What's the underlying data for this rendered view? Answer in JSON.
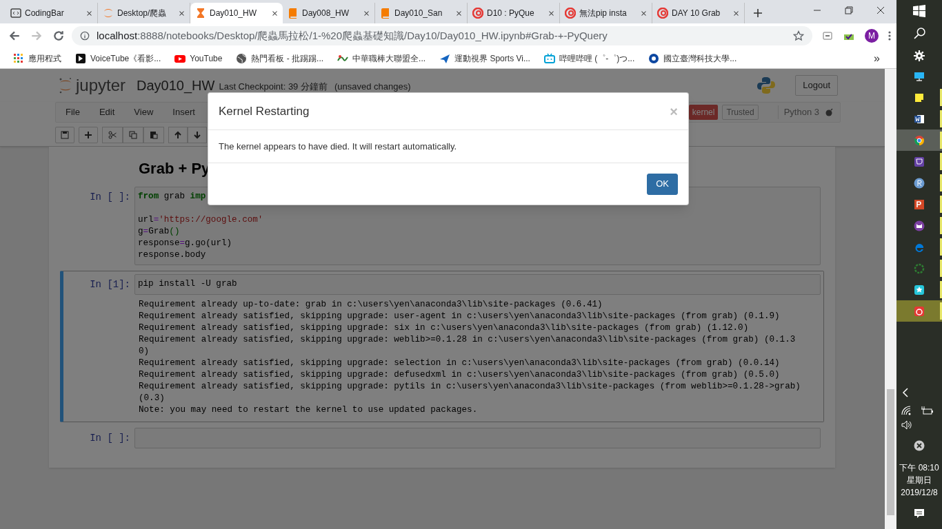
{
  "browser": {
    "tabs": [
      {
        "kind": "code",
        "title": "CodingBar",
        "selected": false
      },
      {
        "kind": "ring",
        "title": "Desktop/爬蟲",
        "selected": false
      },
      {
        "kind": "hourglass",
        "title": "Day010_HW",
        "selected": true
      },
      {
        "kind": "book",
        "title": "Day008_HW",
        "selected": false
      },
      {
        "kind": "book",
        "title": "Day010_San",
        "selected": false
      },
      {
        "kind": "swirl",
        "title": "D10 : PyQue",
        "selected": false
      },
      {
        "kind": "swirl",
        "title": "無法pip insta",
        "selected": false
      },
      {
        "kind": "swirl",
        "title": "DAY 10 Grab",
        "selected": false
      }
    ],
    "url_host": "localhost",
    "url_path": ":8888/notebooks/Desktop/爬蟲馬拉松/1-%20爬蟲基礎知識/Day10/Day010_HW.ipynb#Grab-+-PyQuery",
    "profile": "M",
    "bookmarks": [
      {
        "kind": "apps",
        "label": "應用程式"
      },
      {
        "kind": "voicetube",
        "label": "VoiceTube《看影..."
      },
      {
        "kind": "youtube",
        "label": "YouTube"
      },
      {
        "kind": "globe",
        "label": "熱門看板 - 批踢踢..."
      },
      {
        "kind": "cpbl",
        "label": "中華職棒大聯盟全..."
      },
      {
        "kind": "plane",
        "label": "運動視界 Sports Vi..."
      },
      {
        "kind": "tv",
        "label": "哔哩哔哩 (゜-゜)つ..."
      },
      {
        "kind": "school",
        "label": "國立臺灣科技大學..."
      }
    ],
    "more": "»"
  },
  "notebook": {
    "logo_text": "jupyter",
    "name": "Day010_HW",
    "checkpoint": "Last Checkpoint: 39 分鐘前",
    "unsaved": "(unsaved changes)",
    "logout": "Logout",
    "menu": [
      "File",
      "Edit",
      "View",
      "Insert"
    ],
    "kernel_status": "kernel",
    "trusted": "Trusted",
    "kernel_name": "Python 3",
    "heading": "Grab + Py",
    "cells": [
      {
        "prompt": "In [ ]:",
        "selected": false,
        "lines": [
          {
            "tokens": [
              {
                "kind": "keyword",
                "text": "from"
              },
              {
                "kind": "plain",
                "text": " grab "
              },
              {
                "kind": "keyword",
                "text": "imp"
              }
            ]
          },
          {
            "blank": true
          },
          {
            "tokens": [
              {
                "kind": "plain",
                "text": "url"
              },
              {
                "kind": "operator",
                "text": "="
              },
              {
                "kind": "string",
                "text": "'https://google.com'"
              }
            ]
          },
          {
            "tokens": [
              {
                "kind": "plain",
                "text": "g"
              },
              {
                "kind": "operator",
                "text": "="
              },
              {
                "kind": "plain",
                "text": "Grab"
              },
              {
                "kind": "paren",
                "text": "()"
              }
            ]
          },
          {
            "tokens": [
              {
                "kind": "plain",
                "text": "response"
              },
              {
                "kind": "operator",
                "text": "="
              },
              {
                "kind": "plain",
                "text": "g.go(url)"
              }
            ]
          },
          {
            "tokens": [
              {
                "kind": "plain",
                "text": "response.body"
              }
            ]
          }
        ]
      },
      {
        "prompt": "In [1]:",
        "selected": true,
        "lines": [
          {
            "tokens": [
              {
                "kind": "plain",
                "text": "pip install -U grab"
              }
            ]
          }
        ],
        "output": [
          "Requirement already up-to-date: grab in c:\\users\\yen\\anaconda3\\lib\\site-packages (0.6.41)",
          "Requirement already satisfied, skipping upgrade: user-agent in c:\\users\\yen\\anaconda3\\lib\\site-packages (from grab) (0.1.9)",
          "Requirement already satisfied, skipping upgrade: six in c:\\users\\yen\\anaconda3\\lib\\site-packages (from grab) (1.12.0)",
          "Requirement already satisfied, skipping upgrade: weblib>=0.1.28 in c:\\users\\yen\\anaconda3\\lib\\site-packages (from grab) (0.1.3",
          "0)",
          "Requirement already satisfied, skipping upgrade: selection in c:\\users\\yen\\anaconda3\\lib\\site-packages (from grab) (0.0.14)",
          "Requirement already satisfied, skipping upgrade: defusedxml in c:\\users\\yen\\anaconda3\\lib\\site-packages (from grab) (0.5.0)",
          "Requirement already satisfied, skipping upgrade: pytils in c:\\users\\yen\\anaconda3\\lib\\site-packages (from weblib>=0.1.28->grab)",
          "(0.3)",
          "Note: you may need to restart the kernel to use updated packages."
        ]
      },
      {
        "prompt": "In [ ]:",
        "selected": false
      }
    ]
  },
  "dialog": {
    "title": "Kernel Restarting",
    "close": "×",
    "message": "The kernel appears to have died. It will restart automatically.",
    "button": "OK"
  },
  "taskbar": {
    "apps": [
      {
        "kind": "monitor",
        "running": false,
        "selected": false,
        "flashing": false
      },
      {
        "kind": "note",
        "running": true,
        "selected": false,
        "flashing": false
      },
      {
        "kind": "word",
        "running": true,
        "selected": false,
        "flashing": false
      },
      {
        "kind": "chrome",
        "running": true,
        "selected": true,
        "flashing": false
      },
      {
        "kind": "twitch",
        "running": true,
        "selected": false,
        "flashing": false
      },
      {
        "kind": "r",
        "running": true,
        "selected": false,
        "flashing": false
      },
      {
        "kind": "ppt",
        "running": true,
        "selected": false,
        "flashing": false
      },
      {
        "kind": "cat",
        "running": true,
        "selected": false,
        "flashing": false
      },
      {
        "kind": "edge",
        "running": true,
        "selected": false,
        "flashing": false
      },
      {
        "kind": "ring",
        "running": true,
        "selected": false,
        "flashing": false
      },
      {
        "kind": "star",
        "running": true,
        "selected": false,
        "flashing": false
      },
      {
        "kind": "redapp",
        "running": true,
        "selected": false,
        "flashing": true
      }
    ],
    "time": "下午 08:10",
    "weekday": "星期日",
    "date": "2019/12/8"
  }
}
